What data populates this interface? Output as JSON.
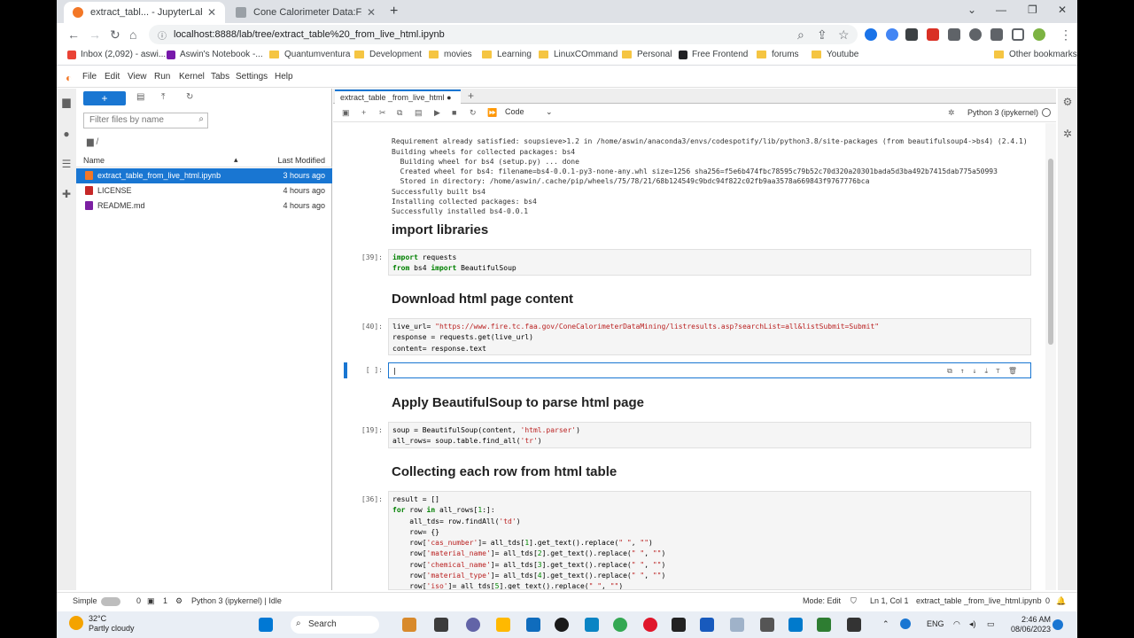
{
  "browser": {
    "tabs": [
      {
        "label": "extract_tabl... - JupyterLab"
      },
      {
        "label": "Cone Calorimeter Data:FAA Fire S"
      }
    ],
    "url": "localhost:8888/lab/tree/extract_table%20_from_live_html.ipynb",
    "bookmarks": [
      "Inbox (2,092) - aswi...",
      "Aswin's Notebook -...",
      "Quantumventura",
      "Development",
      "movies",
      "Learning",
      "LinuxCOmmand",
      "Personal",
      "Free Frontend",
      "forums",
      "Youtube",
      "Other bookmarks"
    ]
  },
  "menu": [
    "File",
    "Edit",
    "View",
    "Run",
    "Kernel",
    "Tabs",
    "Settings",
    "Help"
  ],
  "filebrowser": {
    "filter_placeholder": "Filter files by name",
    "breadcrumb": "/",
    "col_name": "Name",
    "col_modified": "Last Modified",
    "files": [
      {
        "name": "extract_table_from_live_html.ipynb",
        "modified": "3 hours ago"
      },
      {
        "name": "LICENSE",
        "modified": "4 hours ago"
      },
      {
        "name": "README.md",
        "modified": "4 hours ago"
      }
    ]
  },
  "notebook": {
    "tab": "extract_table _from_live_html",
    "cell_type": "Code",
    "kernel": "Python 3 (ipykernel)",
    "output_lines": [
      "Requirement already satisfied: soupsieve>1.2 in /home/aswin/anaconda3/envs/codespotify/lib/python3.8/site-packages (from beautifulsoup4->bs4) (2.4.1)",
      "Building wheels for collected packages: bs4",
      "  Building wheel for bs4 (setup.py) ... done",
      "  Created wheel for bs4: filename=bs4-0.0.1-py3-none-any.whl size=1256 sha256=f5e6b474fbc78595c79b52c70d320a20301bada5d3ba492b7415dab775a50993",
      "  Stored in directory: /home/aswin/.cache/pip/wheels/75/78/21/68b124549c9bdc94f822c02fb9aa3578a669843f9767776bca",
      "Successfully built bs4",
      "Installing collected packages: bs4",
      "Successfully installed bs4-0.0.1"
    ],
    "heading1": "import libraries",
    "prompt1": "[39]:",
    "heading2": "Download html page content",
    "prompt2": "[40]:",
    "prompt_active": "[ ]:",
    "heading3": "Apply BeautifulSoup to parse html page",
    "prompt3": "[19]:",
    "heading4": "Collecting each row from html table",
    "prompt4": "[36]:"
  },
  "statusbar": {
    "mode_simple": "Simple",
    "counts_a": "0",
    "counts_b": "1",
    "kernel_status": "Python 3 (ipykernel) | Idle",
    "mode": "Mode: Edit",
    "position": "Ln 1, Col 1",
    "file": "extract_table _from_live_html.ipynb",
    "notifications": "0"
  },
  "taskbar": {
    "temp": "32°C",
    "weather": "Partly cloudy",
    "search": "Search",
    "lang": "ENG",
    "time": "2:46 AM",
    "date": "08/06/2023"
  },
  "colors": {
    "jupyter_blue": "#1976d2",
    "jupyter_orange": "#f37726"
  }
}
